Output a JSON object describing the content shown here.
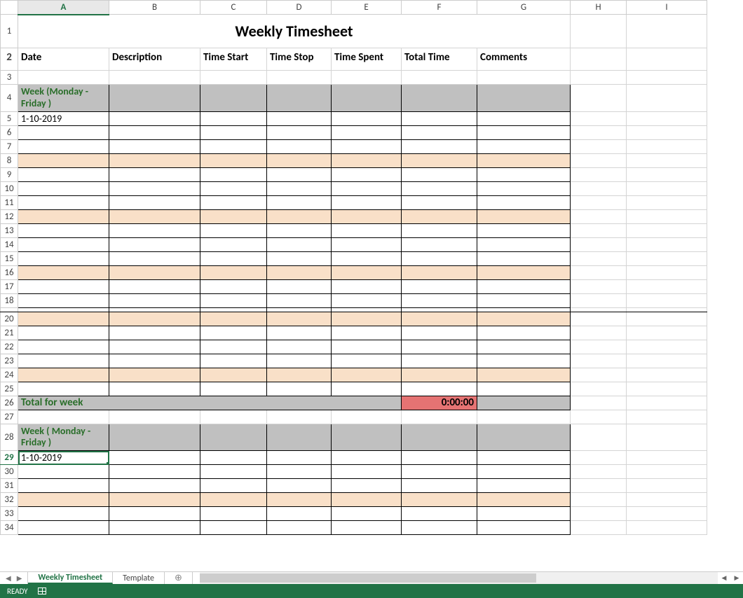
{
  "columns": [
    "A",
    "B",
    "C",
    "D",
    "E",
    "F",
    "G",
    "H",
    "I"
  ],
  "row_numbers": [
    "1",
    "2",
    "3",
    "4",
    "5",
    "6",
    "7",
    "8",
    "9",
    "10",
    "11",
    "12",
    "13",
    "14",
    "15",
    "16",
    "17",
    "18",
    "20",
    "21",
    "22",
    "23",
    "24",
    "25",
    "26",
    "27",
    "28",
    "29",
    "30",
    "31",
    "32",
    "33",
    "34"
  ],
  "title": "Weekly Timesheet",
  "headers": {
    "date": "Date",
    "description": "Description",
    "time_start": "Time Start",
    "time_stop": "Time Stop",
    "time_spent": "Time Spent",
    "total_time": "Total Time",
    "comments": "Comments"
  },
  "week1_label": "Week  (Monday - Friday )",
  "week1_date": "1-10-2019",
  "total_label": "Total for week",
  "total_value": "0:00:00",
  "week2_label": "Week ( Monday - Friday )",
  "week2_date": "1-10-2019",
  "tabs": {
    "active": "Weekly Timesheet",
    "second": "Template"
  },
  "status": "READY",
  "selected_row": "29",
  "selected_col": "A"
}
